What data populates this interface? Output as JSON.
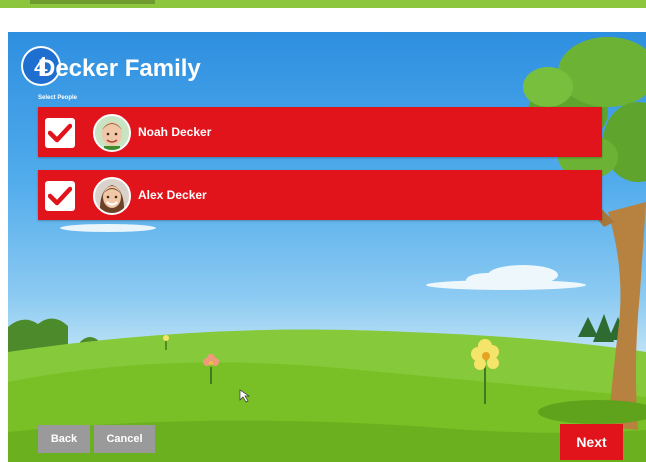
{
  "step": {
    "number": "4"
  },
  "family": {
    "title": "Decker Family"
  },
  "select_label": "Select People",
  "people": [
    {
      "name": "Noah Decker",
      "checked": true
    },
    {
      "name": "Alex Decker",
      "checked": true
    }
  ],
  "buttons": {
    "back": "Back",
    "cancel": "Cancel",
    "next": "Next"
  },
  "colors": {
    "row_red": "#e2141b",
    "button_gray": "#9a9a9a",
    "step_blue": "#1f6fd1",
    "grass_green": "#78c025",
    "top_bar_green": "#8cc63f"
  }
}
